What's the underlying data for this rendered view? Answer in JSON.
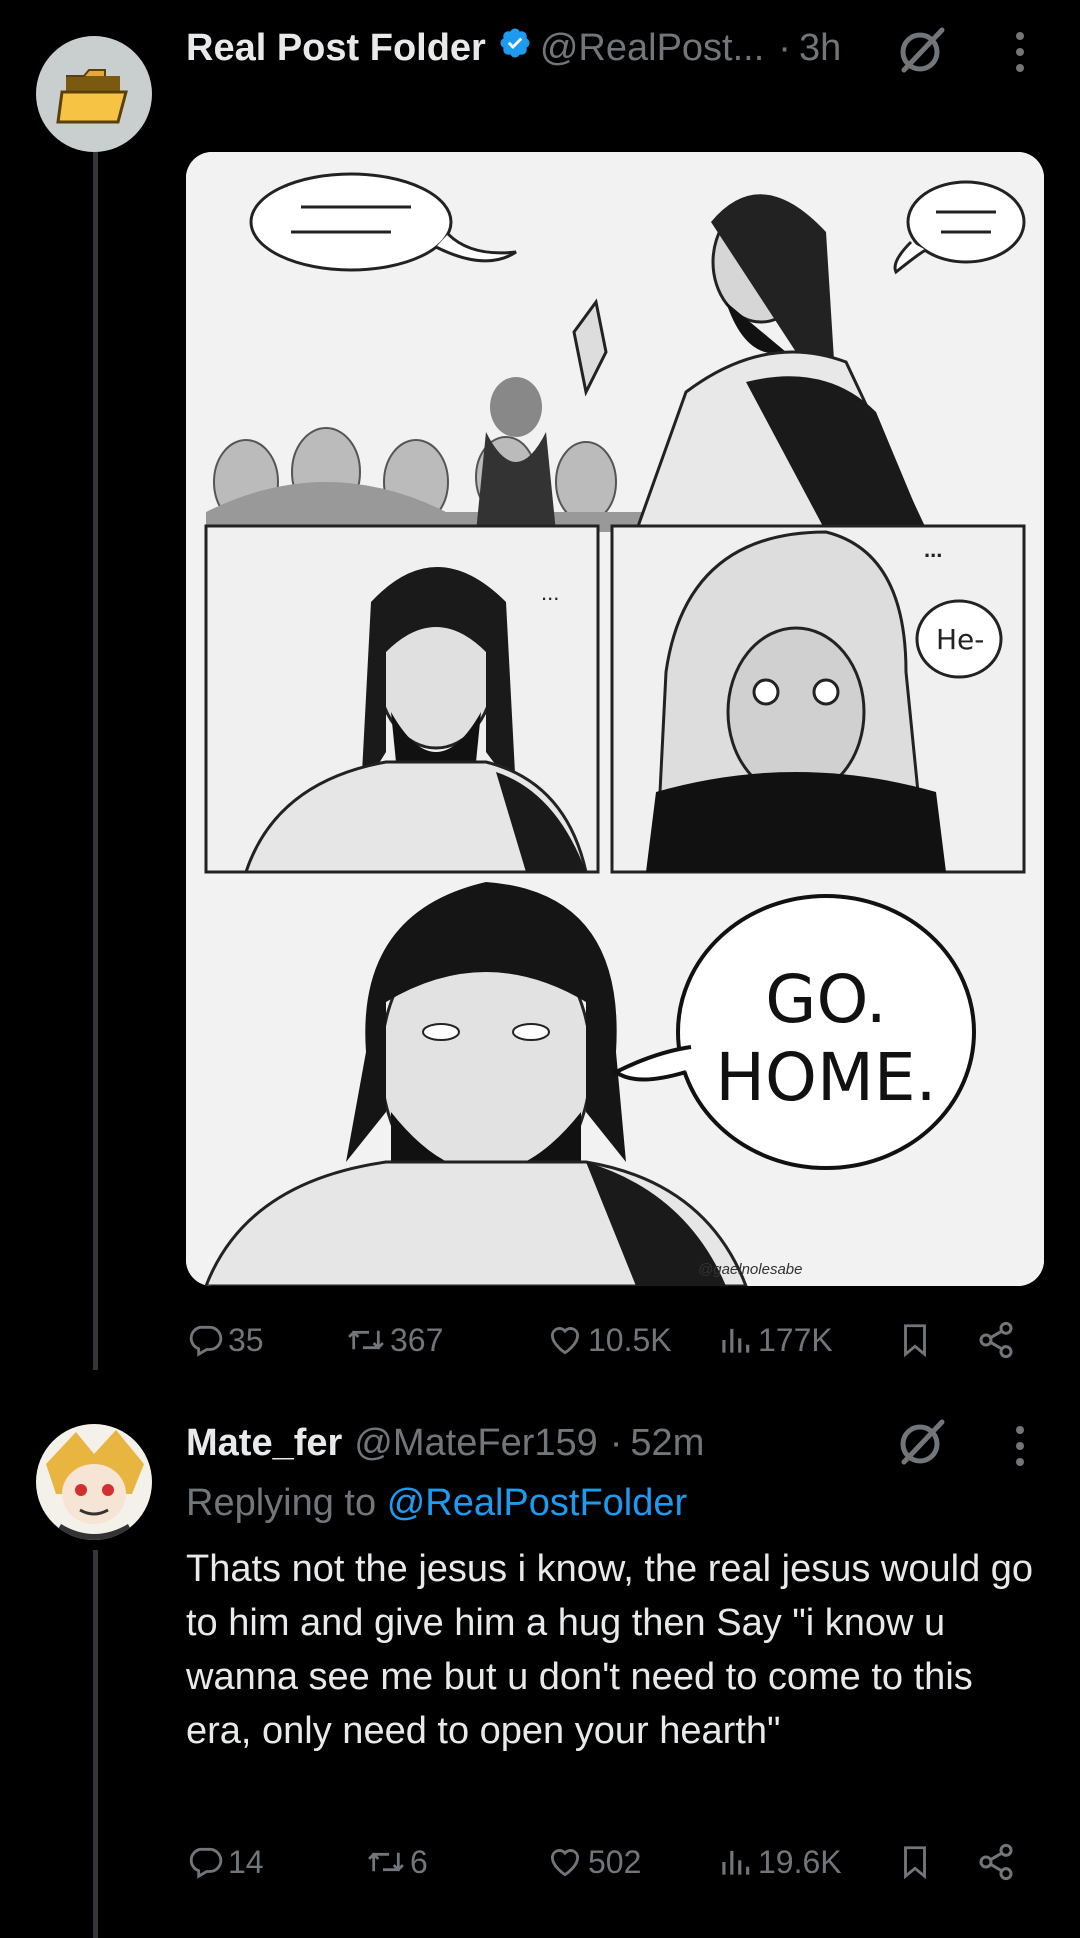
{
  "tweet": {
    "author_name": "Real Post Folder",
    "handle": "@RealPost...",
    "separator": "·",
    "time": "3h",
    "image": {
      "bubble_go": "GO.",
      "bubble_home": "HOME.",
      "bubble_he": "He-",
      "dots": "...",
      "signature": "@gaelnolesabe"
    },
    "stats": {
      "replies": "35",
      "retweets": "367",
      "likes": "10.5K",
      "views": "177K"
    }
  },
  "reply": {
    "author_name": "Mate_fer",
    "handle": "@MateFer159",
    "separator": "·",
    "time": "52m",
    "replying_to_label": "Replying to",
    "replying_to_mention": "@RealPostFolder",
    "text": "Thats not the jesus i know, the real jesus would go to him and give him a hug then Say \"i know u wanna see me but u don't need to come to this era, only need to open your hearth\"",
    "stats": {
      "replies": "14",
      "retweets": "6",
      "likes": "502",
      "views": "19.6K"
    }
  },
  "colors": {
    "background": "#000000",
    "text": "#e7e9ea",
    "muted": "#71767b",
    "link": "#1d9bf0",
    "verified": "#1d9bf0",
    "thread_line": "#333639"
  },
  "icons": [
    "folder-icon",
    "verified-badge-icon",
    "grok-icon",
    "more-icon",
    "reply-icon",
    "retweet-icon",
    "like-icon",
    "views-icon",
    "bookmark-icon",
    "share-icon"
  ]
}
